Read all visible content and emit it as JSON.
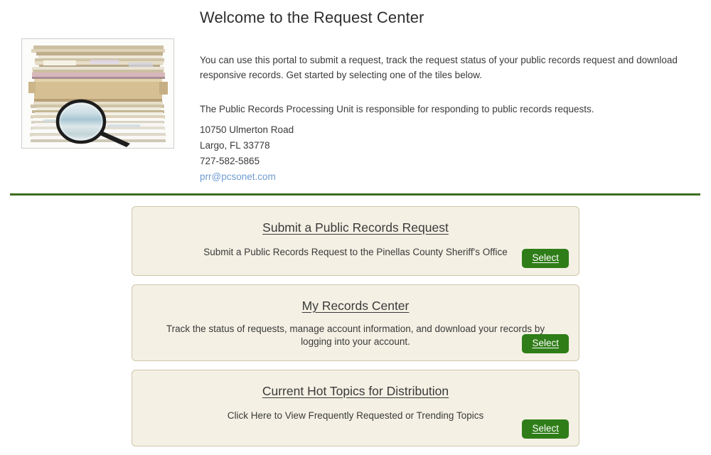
{
  "page": {
    "title": "Welcome to the Request Center"
  },
  "hero": {
    "image_name": "stack-of-files-with-magnifying-glass-photo",
    "alt": "Stack of paper files and folders with a magnifying glass"
  },
  "intro": {
    "paragraph_1": "You can use this portal to submit a request, track the request status of your public records request and download responsive records. Get started by selecting one of the tiles below.",
    "paragraph_2": "The Public Records Processing Unit is responsible for responding to public records requests.",
    "address_line_1": "10750 Ulmerton Road",
    "address_line_2": "Largo, FL 33778",
    "phone": "727-582-5865",
    "email": "prr@pcsonet.com"
  },
  "divider": {
    "color": "#3c6e1f"
  },
  "tiles": [
    {
      "title": "Submit a Public Records Request",
      "description": "Submit a Public Records Request to the Pinellas County Sheriff's Office",
      "button_label": "Select"
    },
    {
      "title": "My Records Center",
      "description": "Track the status of requests, manage account information, and download your records by logging into your account.",
      "button_label": "Select"
    },
    {
      "title": "Current Hot Topics for Distribution",
      "description": "Click Here to View Frequently Requested or Trending Topics",
      "button_label": "Select"
    }
  ],
  "colors": {
    "accent_green": "#3c6e1f",
    "button_green": "#2f7d18",
    "tile_background": "#f4f0e4",
    "tile_border": "#cfc6ac",
    "link_blue": "#6f9bd1",
    "text": "#3a3a3a"
  }
}
